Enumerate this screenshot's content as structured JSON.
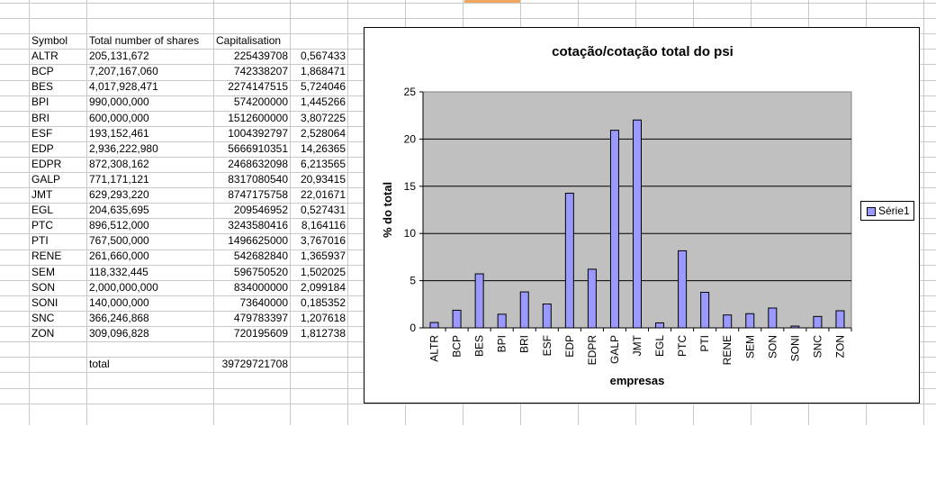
{
  "sheet": {
    "headers": [
      "Symbol",
      "Total number of shares",
      "Capitalisation"
    ],
    "rows": [
      {
        "symbol": "ALTR",
        "shares": "205,131,672",
        "cap": "225439708",
        "pct": "0,567433"
      },
      {
        "symbol": "BCP",
        "shares": "7,207,167,060",
        "cap": "742338207",
        "pct": "1,868471"
      },
      {
        "symbol": "BES",
        "shares": "4,017,928,471",
        "cap": "2274147515",
        "pct": "5,724046"
      },
      {
        "symbol": "BPI",
        "shares": "990,000,000",
        "cap": "574200000",
        "pct": "1,445266"
      },
      {
        "symbol": "BRI",
        "shares": "600,000,000",
        "cap": "1512600000",
        "pct": "3,807225"
      },
      {
        "symbol": "ESF",
        "shares": "193,152,461",
        "cap": "1004392797",
        "pct": "2,528064"
      },
      {
        "symbol": "EDP",
        "shares": "2,936,222,980",
        "cap": "5666910351",
        "pct": "14,26365"
      },
      {
        "symbol": "EDPR",
        "shares": "872,308,162",
        "cap": "2468632098",
        "pct": "6,213565"
      },
      {
        "symbol": "GALP",
        "shares": "771,171,121",
        "cap": "8317080540",
        "pct": "20,93415"
      },
      {
        "symbol": "JMT",
        "shares": "629,293,220",
        "cap": "8747175758",
        "pct": "22,01671"
      },
      {
        "symbol": "EGL",
        "shares": "204,635,695",
        "cap": "209546952",
        "pct": "0,527431"
      },
      {
        "symbol": "PTC",
        "shares": "896,512,000",
        "cap": "3243580416",
        "pct": "8,164116"
      },
      {
        "symbol": "PTI",
        "shares": "767,500,000",
        "cap": "1496625000",
        "pct": "3,767016"
      },
      {
        "symbol": "RENE",
        "shares": "261,660,000",
        "cap": "542682840",
        "pct": "1,365937"
      },
      {
        "symbol": "SEM",
        "shares": "118,332,445",
        "cap": "596750520",
        "pct": "1,502025"
      },
      {
        "symbol": "SON",
        "shares": "2,000,000,000",
        "cap": "834000000",
        "pct": "2,099184"
      },
      {
        "symbol": "SONI",
        "shares": "140,000,000",
        "cap": "73640000",
        "pct": "0,185352"
      },
      {
        "symbol": "SNC",
        "shares": "366,246,868",
        "cap": "479783397",
        "pct": "1,207618"
      },
      {
        "symbol": "ZON",
        "shares": "309,096,828",
        "cap": "720195609",
        "pct": "1,812738"
      }
    ],
    "total_label": "total",
    "total_value": "39729721708"
  },
  "chart_data": {
    "type": "bar",
    "title": "cotação/cotação total do psi",
    "xlabel": "empresas",
    "ylabel": "% do total",
    "ylim": [
      0,
      25
    ],
    "yticks": [
      "0",
      "5",
      "10",
      "15",
      "20",
      "25"
    ],
    "categories": [
      "ALTR",
      "BCP",
      "BES",
      "BPI",
      "BRI",
      "ESF",
      "EDP",
      "EDPR",
      "GALP",
      "JMT",
      "EGL",
      "PTC",
      "PTI",
      "RENE",
      "SEM",
      "SON",
      "SONI",
      "SNC",
      "ZON"
    ],
    "series": [
      {
        "name": "Série1",
        "values": [
          0.567433,
          1.868471,
          5.724046,
          1.445266,
          3.807225,
          2.528064,
          14.26365,
          6.213565,
          20.93415,
          22.01671,
          0.527431,
          8.164116,
          3.767016,
          1.365937,
          1.502025,
          2.099184,
          0.185352,
          1.207618,
          1.812738
        ]
      }
    ],
    "grid": true,
    "legend": "right",
    "colors": {
      "bar": "#9999ff",
      "plot_bg": "#c0c0c0"
    }
  }
}
